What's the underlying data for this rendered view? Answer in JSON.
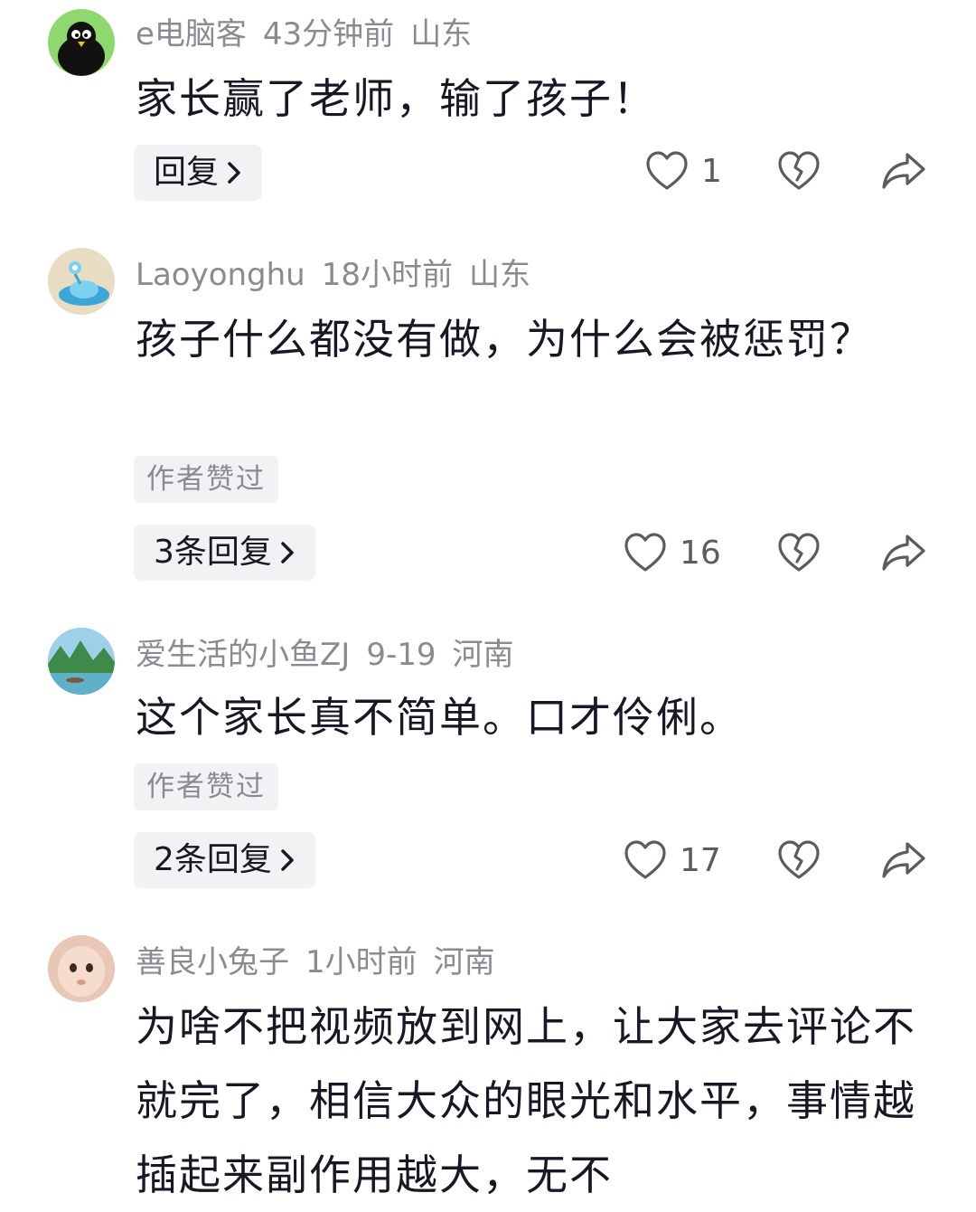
{
  "comments": [
    {
      "username": "e电脑客",
      "time": "43分钟前",
      "location": "山东",
      "text": "家长赢了老师，输了孩子！",
      "reply_label": "回复",
      "likes": "1"
    },
    {
      "username": "Laoyonghu",
      "time": "18小时前",
      "location": "山东",
      "text": "孩子什么都没有做，为什么会被惩罚？",
      "tag": "作者赞过",
      "reply_label": "3条回复",
      "likes": "16"
    },
    {
      "username": "爱生活的小鱼ZJ",
      "time": "9-19",
      "location": "河南",
      "text": "这个家长真不简单。口才伶俐。",
      "tag": "作者赞过",
      "reply_label": "2条回复",
      "likes": "17"
    },
    {
      "username": "善良小兔子",
      "time": "1小时前",
      "location": "河南",
      "text": "为啥不把视频放到网上，让大家去评论不就完了，相信大众的眼光和水平，事情越插起来副作用越大，无不"
    }
  ],
  "icons": {
    "like": "heart-outline-icon",
    "dislike": "broken-heart-icon",
    "share": "share-arrow-icon",
    "reply_chevron": "chevron-right-icon"
  }
}
